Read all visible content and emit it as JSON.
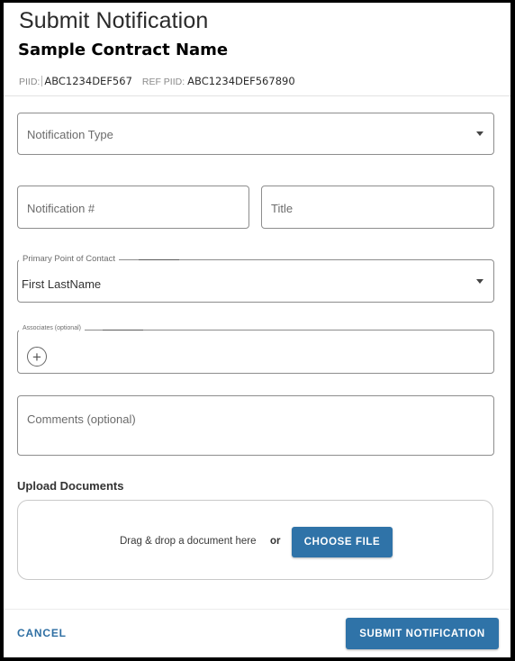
{
  "dialog": {
    "title": "Submit Notification",
    "contract_name": "Sample Contract Name",
    "piid_label": "PIID:",
    "piid_value": "ABC1234DEF567",
    "ref_piid_label": "REF PIID:",
    "ref_piid_value": "ABC1234DEF567890"
  },
  "form": {
    "notification_type": {
      "placeholder": "Notification Type",
      "icon": "caret-down-icon"
    },
    "notification_number": {
      "placeholder": "Notification #"
    },
    "title": {
      "placeholder": "Title"
    },
    "primary_contact": {
      "label": "Primary Point of Contact",
      "value": "First LastName",
      "icon": "caret-down-icon"
    },
    "associates": {
      "label": "Associates (optional)",
      "add_icon": "plus-circle-icon",
      "add_glyph": "+"
    },
    "comments": {
      "placeholder": "Comments (optional)"
    }
  },
  "upload": {
    "section_label": "Upload Documents",
    "drop_text": "Drag & drop a document here",
    "or_text": "or",
    "choose_button": "CHOOSE FILE"
  },
  "footer": {
    "cancel_button": "CANCEL",
    "submit_button": "SUBMIT NOTIFICATION"
  },
  "colors": {
    "primary": "#2f73a8",
    "link": "#2f6fa3",
    "border": "#8d8d8d"
  }
}
